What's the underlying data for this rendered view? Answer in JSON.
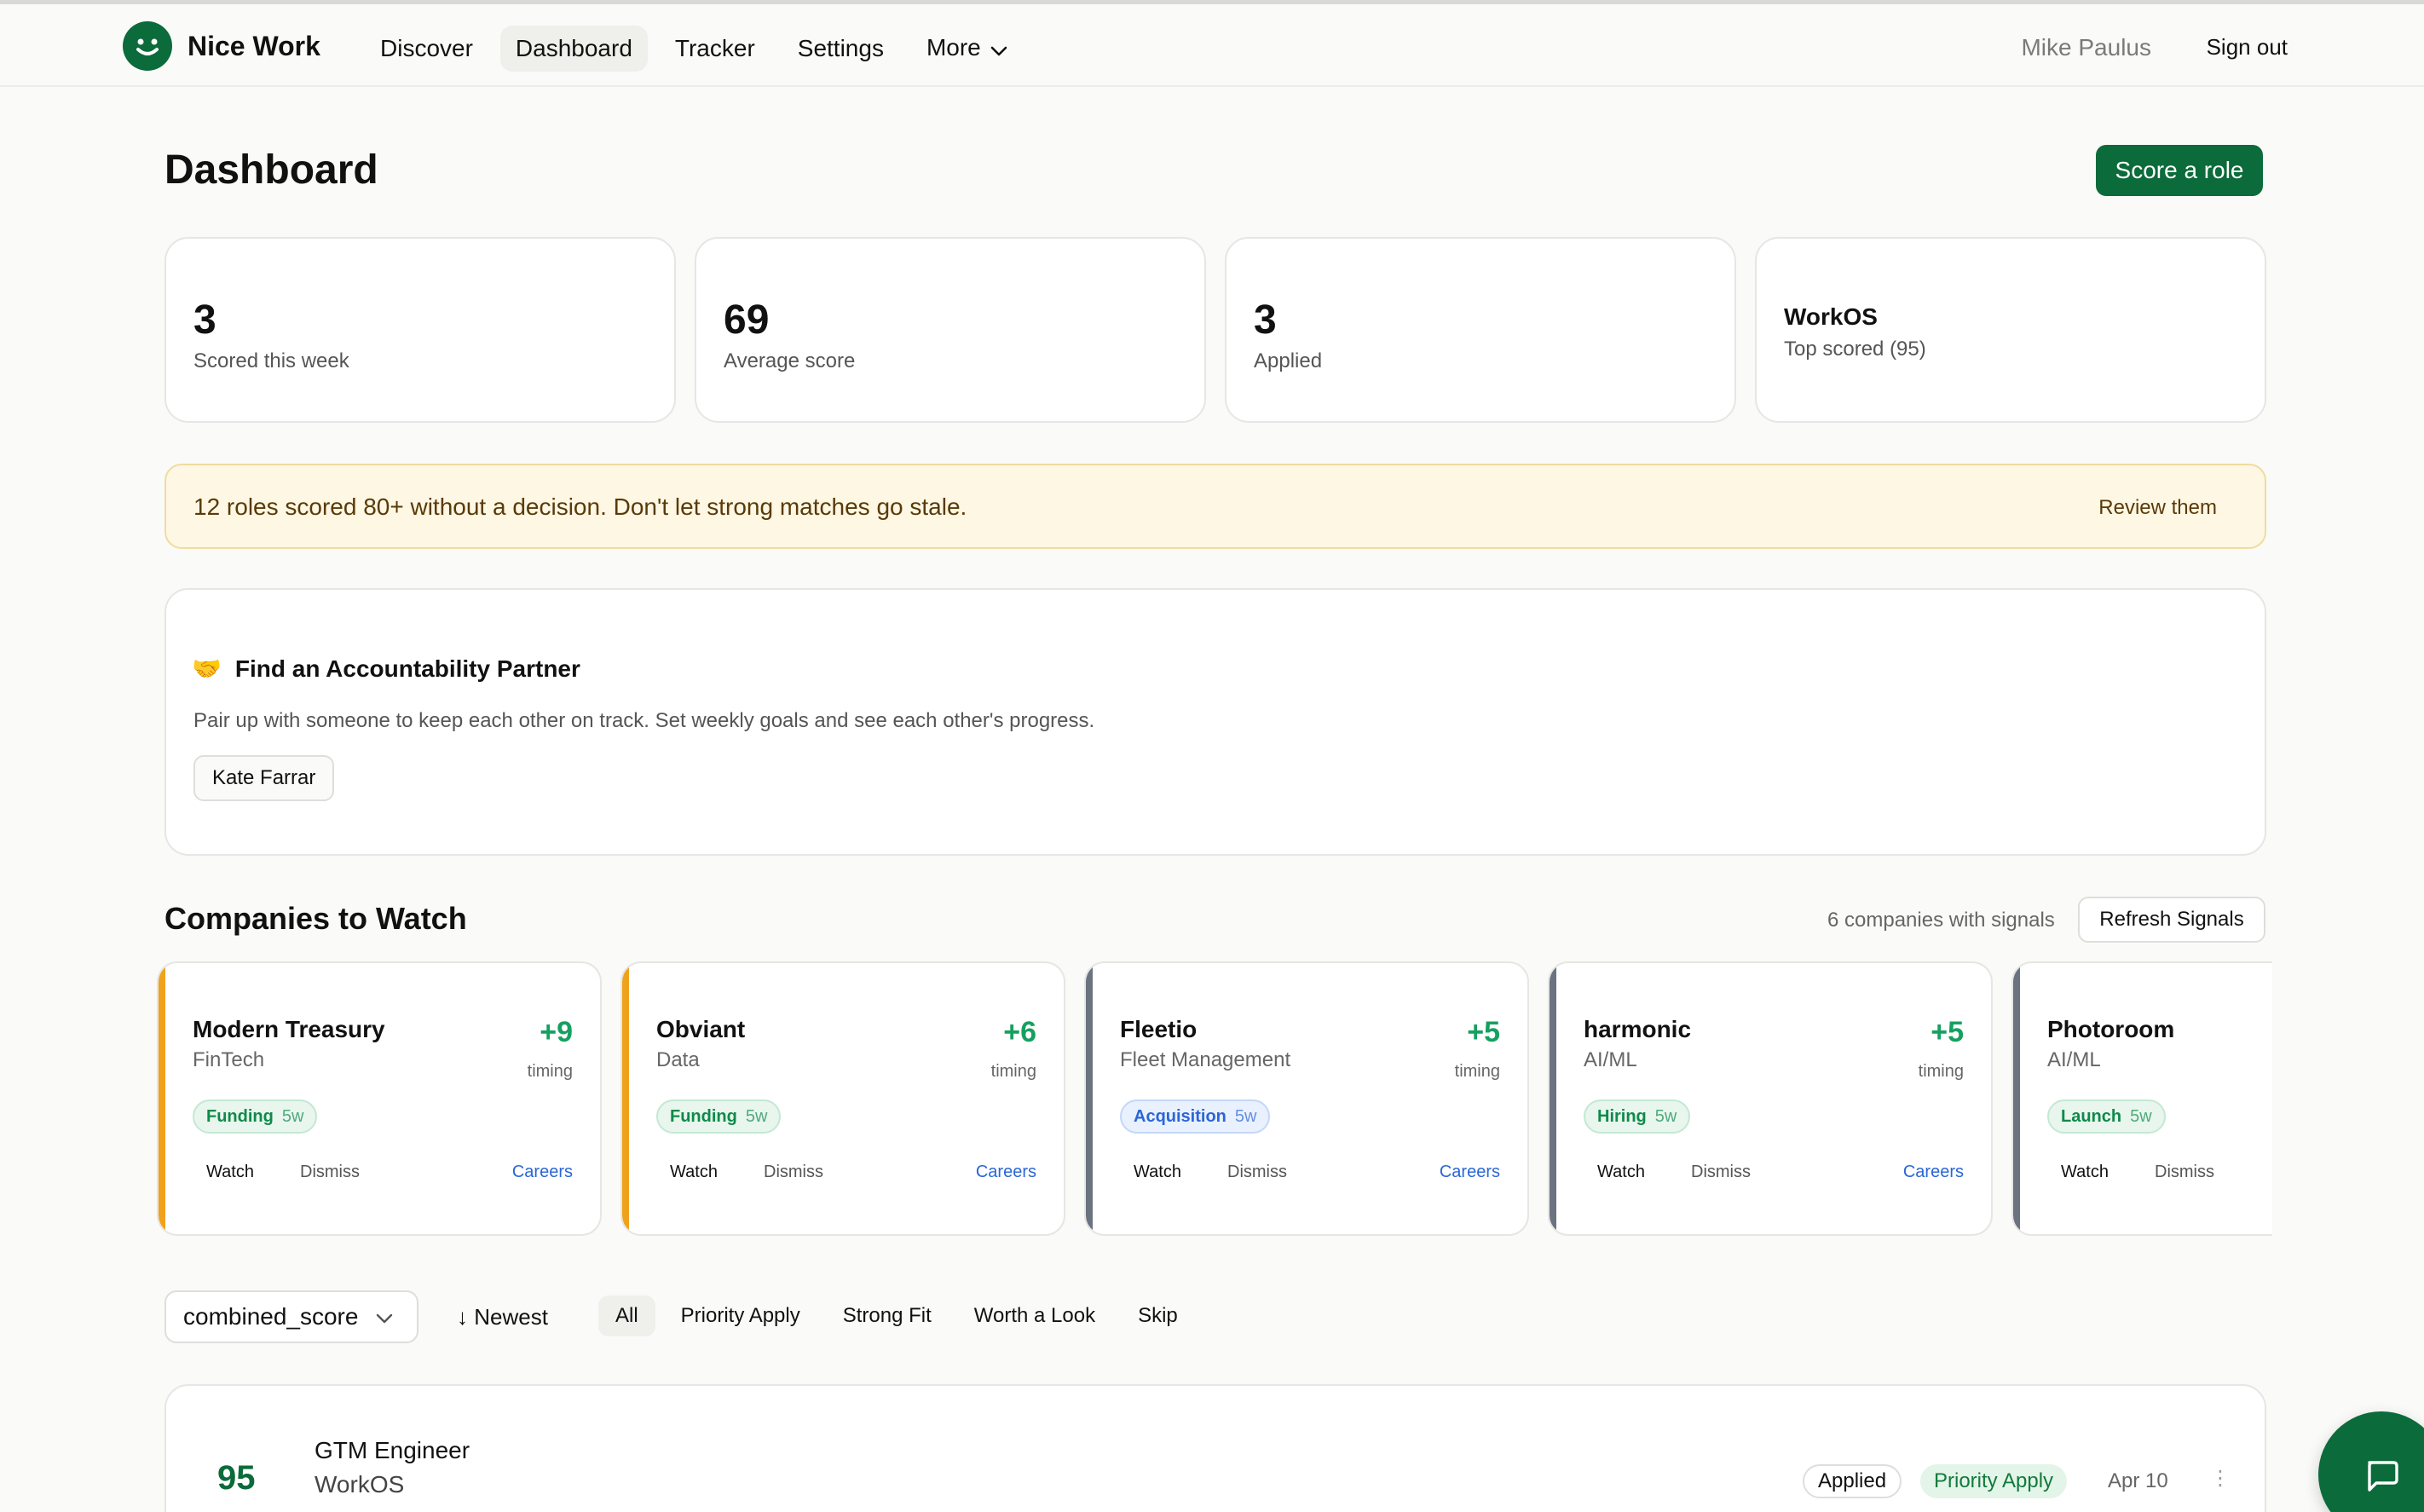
{
  "nav": {
    "brand": "Nice Work",
    "links": [
      "Discover",
      "Dashboard",
      "Tracker",
      "Settings",
      "More"
    ],
    "active": "Dashboard",
    "user": "Mike Paulus",
    "signout": "Sign out"
  },
  "header": {
    "title": "Dashboard",
    "cta": "Score a role"
  },
  "stats": [
    {
      "value": "3",
      "label": "Scored this week"
    },
    {
      "value": "69",
      "label": "Average score"
    },
    {
      "value": "3",
      "label": "Applied"
    },
    {
      "name": "WorkOS",
      "label": "Top scored (95)"
    }
  ],
  "alert": {
    "message": "12 roles scored 80+ without a decision. Don't let strong matches go stale.",
    "link": "Review them"
  },
  "partner": {
    "icon": "🤝",
    "title": "Find an Accountability Partner",
    "description": "Pair up with someone to keep each other on track. Set weekly goals and see each other's progress.",
    "partner_name": "Kate Farrar"
  },
  "companies": {
    "title": "Companies to Watch",
    "count": "6 companies with signals",
    "refresh": "Refresh Signals",
    "watch_label": "Watch",
    "dismiss_label": "Dismiss",
    "careers_label": "Careers",
    "timing_label": "timing",
    "items": [
      {
        "name": "Modern Treasury",
        "industry": "FinTech",
        "delta": "+9",
        "tag": "Funding",
        "age": "5w",
        "tag_color": "green",
        "stripe": "#f0a21c"
      },
      {
        "name": "Obviant",
        "industry": "Data",
        "delta": "+6",
        "tag": "Funding",
        "age": "5w",
        "tag_color": "green",
        "stripe": "#f0a21c"
      },
      {
        "name": "Fleetio",
        "industry": "Fleet Management",
        "delta": "+5",
        "tag": "Acquisition",
        "age": "5w",
        "tag_color": "blue",
        "stripe": "#6b7280"
      },
      {
        "name": "harmonic",
        "industry": "AI/ML",
        "delta": "+5",
        "tag": "Hiring",
        "age": "5w",
        "tag_color": "green",
        "stripe": "#6b7280"
      },
      {
        "name": "Photoroom",
        "industry": "AI/ML",
        "delta": "",
        "tag": "Launch",
        "age": "5w",
        "tag_color": "green",
        "stripe": "#6b7280"
      }
    ]
  },
  "filters": {
    "sort": "combined_score",
    "order": "↓ Newest",
    "tabs": [
      "All",
      "Priority Apply",
      "Strong Fit",
      "Worth a Look",
      "Skip"
    ],
    "active": "All"
  },
  "role": {
    "score": "95",
    "title": "GTM Engineer",
    "company": "WorkOS",
    "status": "Applied",
    "label": "Priority Apply",
    "date": "Apr 10"
  },
  "colors": {
    "brand": "#0b6b3a",
    "positive": "#16a060",
    "alert_bg": "#fdf7e3"
  }
}
